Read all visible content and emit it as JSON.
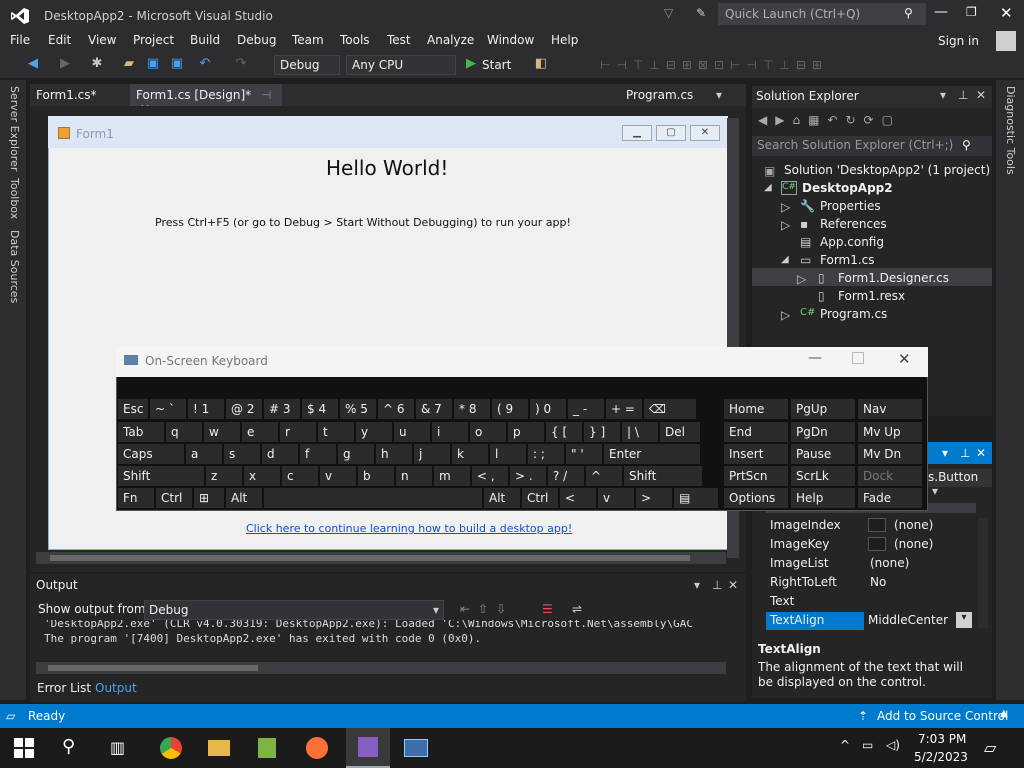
{
  "window": {
    "title": "DesktopApp2 - Microsoft Visual Studio",
    "quick_launch": "Quick Launch (Ctrl+Q)",
    "sign_in": "Sign in"
  },
  "menu": [
    "File",
    "Edit",
    "View",
    "Project",
    "Build",
    "Debug",
    "Team",
    "Tools",
    "Test",
    "Analyze",
    "Window",
    "Help"
  ],
  "toolbar": {
    "config": "Debug",
    "platform": "Any CPU",
    "start": "Start"
  },
  "tabs": [
    {
      "label": "Form1.cs*"
    },
    {
      "label": "Form1.cs [Design]*"
    },
    {
      "label": "Program.cs"
    }
  ],
  "left_side": [
    "Server Explorer",
    "Toolbox",
    "Data Sources"
  ],
  "right_side": [
    "Diagnostic Tools"
  ],
  "form": {
    "title": "Form1",
    "hello": "Hello World!",
    "instructions": "Press Ctrl+F5 (or go to Debug > Start Without Debugging) to run your app!",
    "link": "Click here to continue learning how to build a desktop app!"
  },
  "solution_explorer": {
    "title": "Solution Explorer",
    "search": "Search Solution Explorer (Ctrl+;)",
    "items": [
      {
        "label": "Solution 'DesktopApp2' (1 project)"
      },
      {
        "label": "DesktopApp2"
      },
      {
        "label": "Properties"
      },
      {
        "label": "References"
      },
      {
        "label": "App.config"
      },
      {
        "label": "Form1.cs"
      },
      {
        "label": "Form1.Designer.cs"
      },
      {
        "label": "Form1.resx"
      },
      {
        "label": "Program.cs"
      }
    ]
  },
  "properties": {
    "object": "s.Button",
    "rows": [
      {
        "name": "ImageIndex",
        "value": "(none)"
      },
      {
        "name": "ImageKey",
        "value": "(none)"
      },
      {
        "name": "ImageList",
        "value": "(none)"
      },
      {
        "name": "RightToLeft",
        "value": "No"
      },
      {
        "name": "Text",
        "value": ""
      },
      {
        "name": "TextAlign",
        "value": "MiddleCenter"
      }
    ],
    "desc_title": "TextAlign",
    "desc_text": "The alignment of the text that will be displayed on the control."
  },
  "output": {
    "title": "Output",
    "show_from_label": "Show output from:",
    "source": "Debug",
    "lines": [
      "'DesktopApp2.exe' (CLR v4.0.30319: DesktopApp2.exe): Loaded 'C:\\Windows\\Microsoft.Net\\assembly\\GAC",
      "The program '[7400] DesktopApp2.exe' has exited with code 0 (0x0)."
    ],
    "tabs": [
      "Error List",
      "Output"
    ]
  },
  "status": {
    "ready": "Ready",
    "source_control": "Add to Source Control"
  },
  "osk": {
    "title": "On-Screen Keyboard",
    "row1": [
      [
        "Esc",
        ""
      ],
      [
        "~",
        "`"
      ],
      [
        "!",
        "1"
      ],
      [
        "@",
        "2"
      ],
      [
        "#",
        "3"
      ],
      [
        "$",
        "4"
      ],
      [
        "%",
        "5"
      ],
      [
        "^",
        "6"
      ],
      [
        "&",
        "7"
      ],
      [
        "*",
        "8"
      ],
      [
        "(",
        "9"
      ],
      [
        ")",
        "0"
      ],
      [
        "_",
        "-"
      ],
      [
        "+",
        "="
      ],
      [
        "⌫",
        ""
      ]
    ],
    "row2": [
      "Tab",
      "q",
      "w",
      "e",
      "r",
      "t",
      "y",
      "u",
      "i",
      "o",
      "p",
      "{ [",
      "} ]",
      "| \\",
      "Del"
    ],
    "row3": [
      "Caps",
      "a",
      "s",
      "d",
      "f",
      "g",
      "h",
      "j",
      "k",
      "l",
      ": ;",
      "\" '",
      "Enter"
    ],
    "row4": [
      "Shift",
      "z",
      "x",
      "c",
      "v",
      "b",
      "n",
      "m",
      "< ,",
      "> .",
      "? /",
      "^",
      "Shift"
    ],
    "row5": [
      "Fn",
      "Ctrl",
      "⊞",
      "Alt",
      "",
      "Alt",
      "Ctrl",
      "<",
      "v",
      ">",
      "▤"
    ],
    "nav": [
      [
        "Home",
        "PgUp",
        "Nav"
      ],
      [
        "End",
        "PgDn",
        "Mv Up"
      ],
      [
        "Insert",
        "Pause",
        "Mv Dn"
      ],
      [
        "PrtScn",
        "ScrLk",
        "Dock"
      ],
      [
        "Options",
        "Help",
        "Fade"
      ]
    ]
  },
  "taskbar": {
    "time": "7:03 PM",
    "date": "5/2/2023"
  }
}
